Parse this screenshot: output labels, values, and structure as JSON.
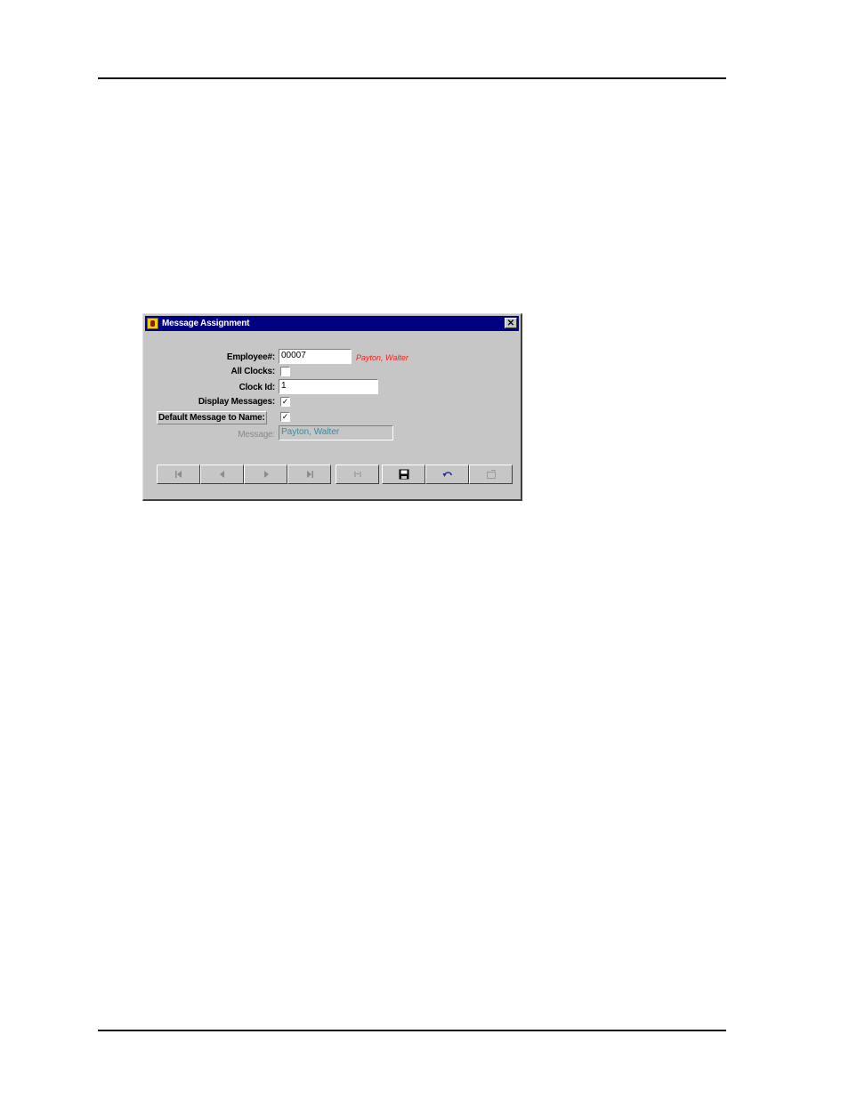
{
  "window": {
    "title": "Message Assignment",
    "close_glyph": "✕"
  },
  "form": {
    "employee_label": "Employee#:",
    "employee_value": "00007",
    "employee_name": "Payton, Walter",
    "all_clocks_label": "All Clocks:",
    "all_clocks_checked": false,
    "clock_id_label": "Clock Id:",
    "clock_id_value": "1",
    "display_messages_label": "Display Messages:",
    "display_messages_checked": true,
    "default_message_label": "Default Message to Name:",
    "default_message_checked": true,
    "message_label": "Message:",
    "message_value": "Payton, Walter"
  },
  "toolbar": {
    "buttons": [
      {
        "name": "first-record-icon",
        "enabled": false
      },
      {
        "name": "previous-record-icon",
        "enabled": false
      },
      {
        "name": "next-record-icon",
        "enabled": false
      },
      {
        "name": "last-record-icon",
        "enabled": false
      },
      {
        "name": "find-icon",
        "enabled": false
      },
      {
        "name": "save-icon",
        "enabled": true
      },
      {
        "name": "undo-icon",
        "enabled": true
      },
      {
        "name": "new-record-icon",
        "enabled": false
      }
    ]
  },
  "colors": {
    "titlebar": "#000080",
    "dialog_bg": "#c6c6c6",
    "employee_name": "#e8241c",
    "disabled_text": "#3f8a9a"
  }
}
